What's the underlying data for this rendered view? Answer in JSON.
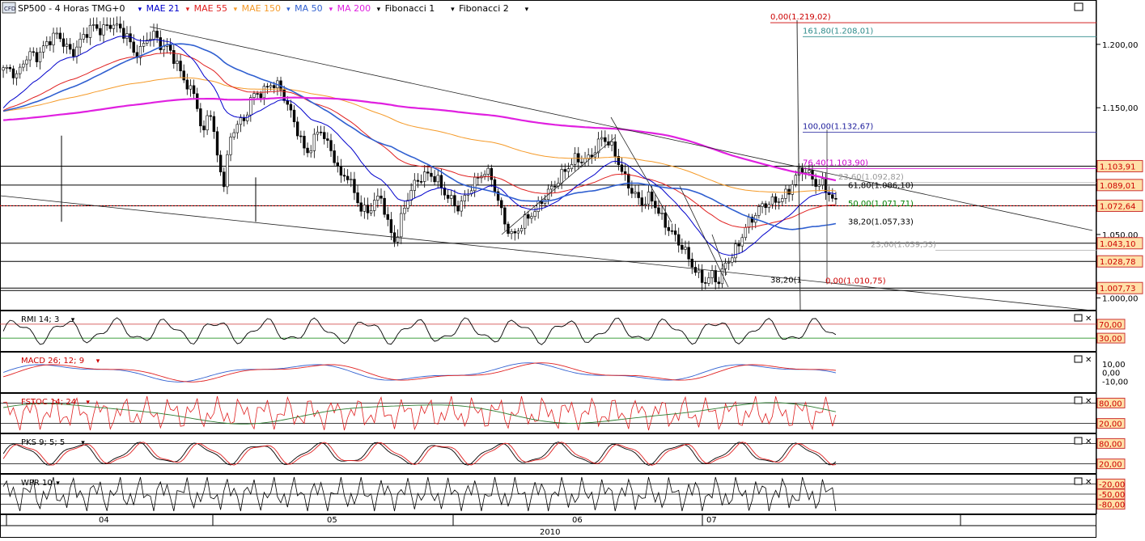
{
  "main_legend": {
    "symbol": "SP500 - 4 Horas  TMG+0",
    "indicators": [
      {
        "label": "MAE 21",
        "color": "#0000cc"
      },
      {
        "label": "MAE 55",
        "color": "#e02020"
      },
      {
        "label": "MAE 150",
        "color": "#f59a28"
      },
      {
        "label": "MA 50",
        "color": "#2f5fd0"
      },
      {
        "label": "MA 200",
        "color": "#e020e0"
      },
      {
        "label": "Fibonacci 1",
        "color": "#000000"
      },
      {
        "label": "Fibonacci 2",
        "color": "#000000"
      }
    ]
  },
  "price_axis": {
    "ticks": [
      {
        "value": 1200,
        "label": "1.200,00"
      },
      {
        "value": 1150,
        "label": "1.150,00"
      },
      {
        "value": 1050,
        "label": "1.050,00"
      },
      {
        "value": 1000,
        "label": "1.000,00"
      }
    ],
    "range": [
      990,
      1235
    ]
  },
  "price_boxes": [
    {
      "value": 1103.91,
      "label": "1.103,91"
    },
    {
      "value": 1089.01,
      "label": "1.089,01"
    },
    {
      "value": 1072.64,
      "label": "1.072,64"
    },
    {
      "value": 1043.1,
      "label": "1.043,10"
    },
    {
      "value": 1028.78,
      "label": "1.028,78"
    },
    {
      "value": 1007.73,
      "label": "1.007,73"
    }
  ],
  "fib_levels": [
    {
      "label": "0,00(1.219,02)",
      "value": 1219.02,
      "color": "#cc0000"
    },
    {
      "label": "161,80(1.208,01)",
      "value": 1208.01,
      "color": "#2e8b8b"
    },
    {
      "label": "100,00(1.132,67)",
      "value": 1132.67,
      "color": "#1a1a9a"
    },
    {
      "label": "76,40(1.103,90)",
      "value": 1103.9,
      "color": "#cc00cc"
    },
    {
      "label": "23,60(1.092,82)",
      "value": 1092.82,
      "color": "#999999"
    },
    {
      "label": "61,80(1.086,10)",
      "value": 1086.1,
      "color": "#000000"
    },
    {
      "label": "50,00(1.071,71)",
      "value": 1071.71,
      "color": "#008000"
    },
    {
      "label": "38,20(1.057,33)",
      "value": 1057.33,
      "color": "#000000"
    },
    {
      "label": "23,60(1.039,53)",
      "value": 1039.53,
      "color": "#999999"
    },
    {
      "label": "38,20(1",
      "value": 1011.5,
      "color": "#000000"
    },
    {
      "label": "0,00(1.010,75)",
      "value": 1010.75,
      "color": "#cc0000"
    }
  ],
  "panels": [
    {
      "name": "rmi",
      "title": "RMI 14; 3",
      "title_color": "#000000",
      "levels": [
        {
          "label": "70,00",
          "value": 70
        },
        {
          "label": "30,00",
          "value": 30
        }
      ],
      "range": [
        0,
        100
      ]
    },
    {
      "name": "macd",
      "title": "MACD 26; 12; 9",
      "title_color": "#cc0000",
      "levels": [
        {
          "label": "10,00",
          "value": 10
        },
        {
          "label": "0,00",
          "value": 0
        },
        {
          "label": "-10,00",
          "value": -10
        }
      ],
      "range": [
        -20,
        20
      ]
    },
    {
      "name": "fstoc",
      "title": "FSTOC 14; 24",
      "title_color": "#cc0000",
      "levels": [
        {
          "label": "80,00",
          "value": 80
        },
        {
          "label": "20,00",
          "value": 20
        }
      ],
      "range": [
        0,
        100
      ]
    },
    {
      "name": "pks",
      "title": "PKS 9; 5; 5",
      "title_color": "#000000",
      "levels": [
        {
          "label": "80,00",
          "value": 80
        },
        {
          "label": "20,00",
          "value": 20
        }
      ],
      "range": [
        0,
        100
      ]
    },
    {
      "name": "wpr",
      "title": "WPR 10",
      "title_color": "#000000",
      "levels": [
        {
          "label": "-20,00",
          "value": -20
        },
        {
          "label": "-50,00",
          "value": -50
        },
        {
          "label": "-80,00",
          "value": -80
        }
      ],
      "range": [
        -100,
        0
      ]
    }
  ],
  "time_axis": {
    "months": [
      "04",
      "05",
      "06",
      "07"
    ],
    "year": "2010"
  },
  "chart_data": {
    "type": "candlestick",
    "title": "SP500 - 4 Horas  TMG+0",
    "x_labels": [
      "04",
      "05",
      "06",
      "07"
    ],
    "year": "2010",
    "ylim": [
      990,
      1235
    ],
    "close_series": [
      1180,
      1178,
      1172,
      1188,
      1195,
      1192,
      1198,
      1203,
      1206,
      1200,
      1195,
      1202,
      1208,
      1212,
      1210,
      1215,
      1219,
      1212,
      1205,
      1190,
      1195,
      1208,
      1210,
      1198,
      1195,
      1185,
      1175,
      1168,
      1160,
      1125,
      1150,
      1112,
      1090,
      1128,
      1140,
      1138,
      1155,
      1160,
      1165,
      1172,
      1168,
      1155,
      1140,
      1128,
      1115,
      1125,
      1135,
      1120,
      1110,
      1095,
      1100,
      1085,
      1070,
      1065,
      1075,
      1080,
      1058,
      1045,
      1065,
      1080,
      1090,
      1098,
      1100,
      1095,
      1082,
      1075,
      1070,
      1080,
      1090,
      1095,
      1098,
      1092,
      1075,
      1060,
      1050,
      1055,
      1060,
      1065,
      1075,
      1085,
      1090,
      1095,
      1100,
      1108,
      1110,
      1112,
      1118,
      1125,
      1120,
      1112,
      1100,
      1090,
      1080,
      1072,
      1078,
      1070,
      1062,
      1055,
      1045,
      1035,
      1025,
      1018,
      1015,
      1020,
      1012,
      1025,
      1032,
      1045,
      1060,
      1065,
      1070,
      1072,
      1075,
      1080,
      1085,
      1095,
      1100,
      1096,
      1090,
      1092,
      1085,
      1074
    ],
    "last": 1072.64,
    "moving_averages": [
      "MAE 21",
      "MAE 55",
      "MAE 150",
      "MA 50",
      "MA 200"
    ]
  }
}
